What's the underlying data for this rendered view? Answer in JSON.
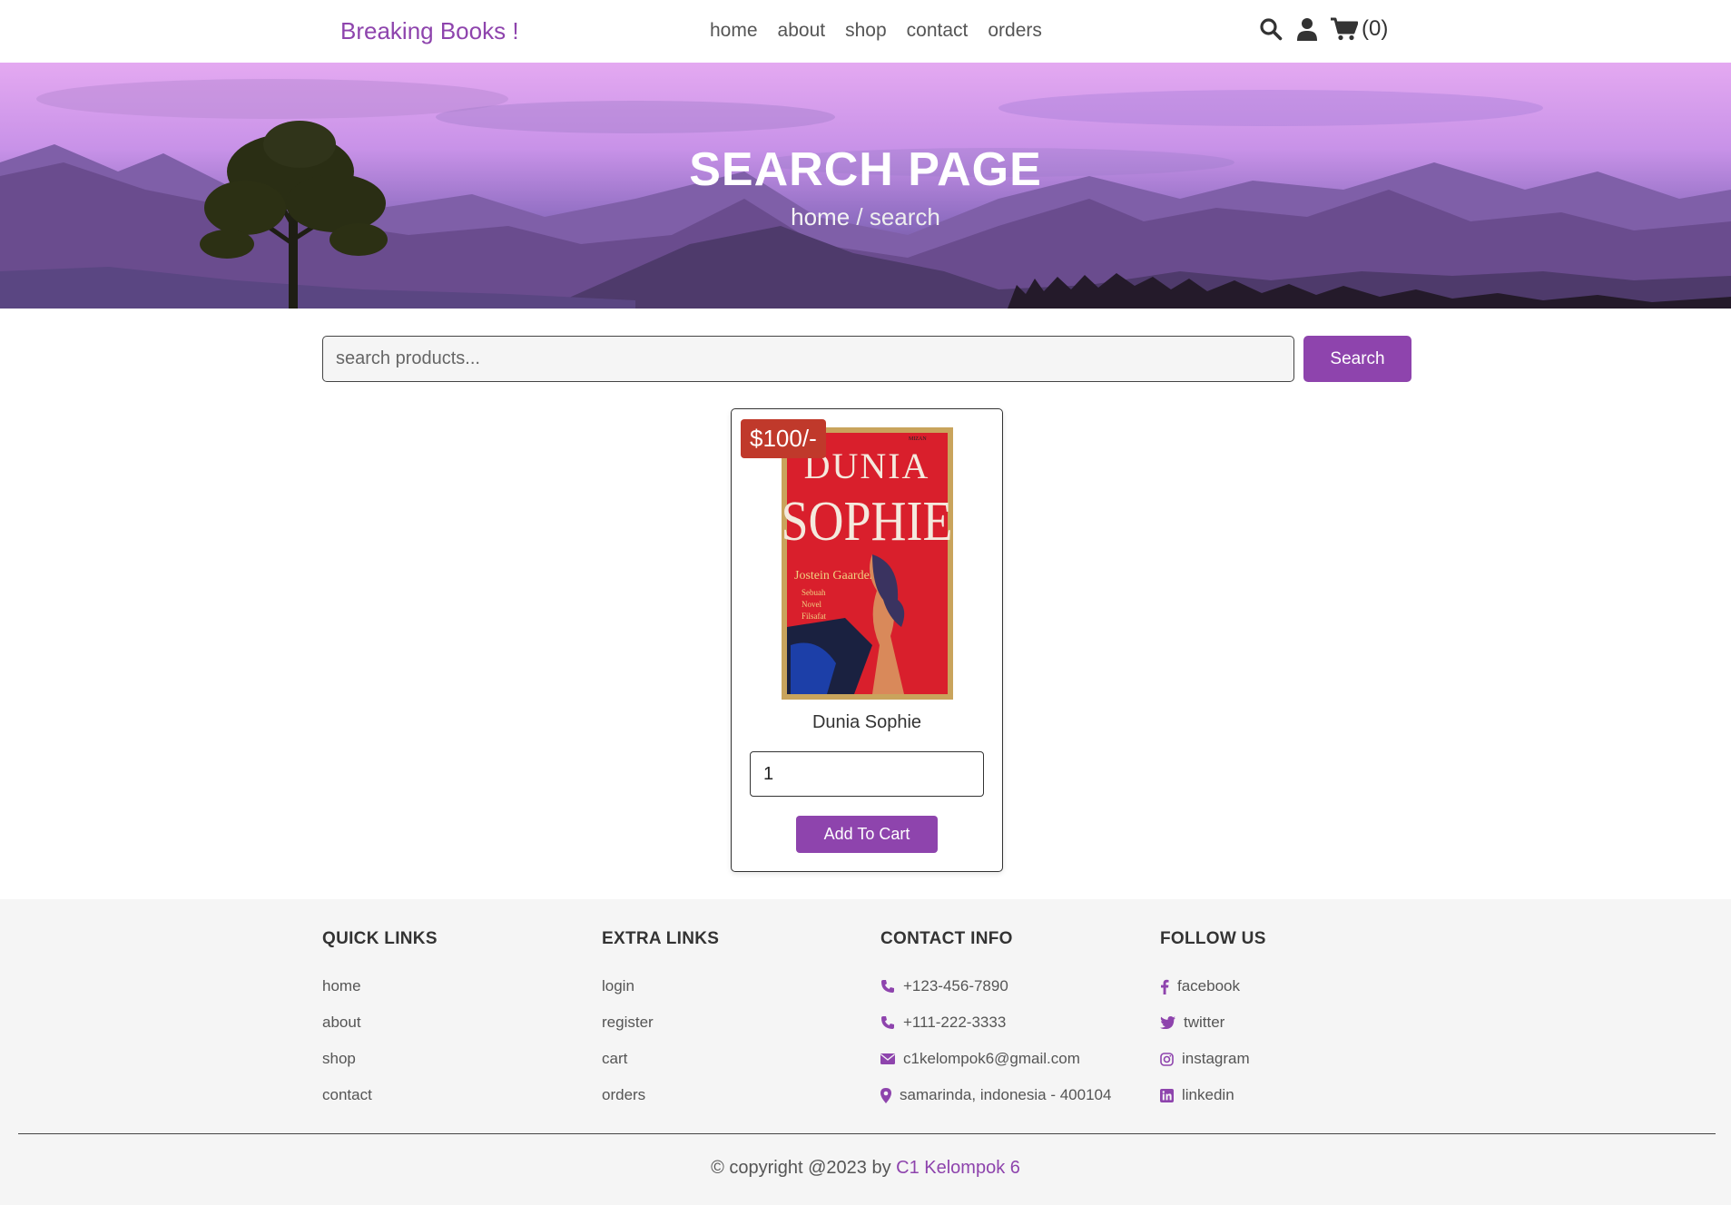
{
  "header": {
    "logo": "Breaking Books !",
    "nav": [
      "home",
      "about",
      "shop",
      "contact",
      "orders"
    ],
    "cart_count": "(0)",
    "icons": [
      "search-icon",
      "user-icon",
      "cart-icon"
    ]
  },
  "hero": {
    "title": "SEARCH PAGE",
    "crumb_home": "home",
    "crumb_sep": " / ",
    "crumb_current": "search"
  },
  "search": {
    "placeholder": "search products...",
    "button": "Search"
  },
  "product": {
    "price": "$100/-",
    "name": "Dunia Sophie",
    "quantity": "1",
    "add_button": "Add To Cart",
    "cover": {
      "title1": "DUNIA",
      "title2": "SOPHIE",
      "author": "Jostein Gaarder",
      "sub1": "Sebuah",
      "sub2": "Novel",
      "sub3": "Filsafat",
      "publisher": "MIZAN"
    }
  },
  "footer": {
    "quick_links": {
      "title": "QUICK LINKS",
      "items": [
        "home",
        "about",
        "shop",
        "contact"
      ]
    },
    "extra_links": {
      "title": "EXTRA LINKS",
      "items": [
        "login",
        "register",
        "cart",
        "orders"
      ]
    },
    "contact_info": {
      "title": "CONTACT INFO",
      "phone1": "+123-456-7890",
      "phone2": "+111-222-3333",
      "email": "c1kelompok6@gmail.com",
      "address": "samarinda, indonesia - 400104"
    },
    "follow_us": {
      "title": "FOLLOW US",
      "items": [
        "facebook",
        "twitter",
        "instagram",
        "linkedin"
      ]
    },
    "credit_prefix": "© copyright @2023 by ",
    "credit_brand": "C1 Kelompok 6"
  },
  "colors": {
    "accent": "#8e44ad",
    "price_badge": "#c0392b",
    "footer_bg": "#f5f5f5"
  }
}
